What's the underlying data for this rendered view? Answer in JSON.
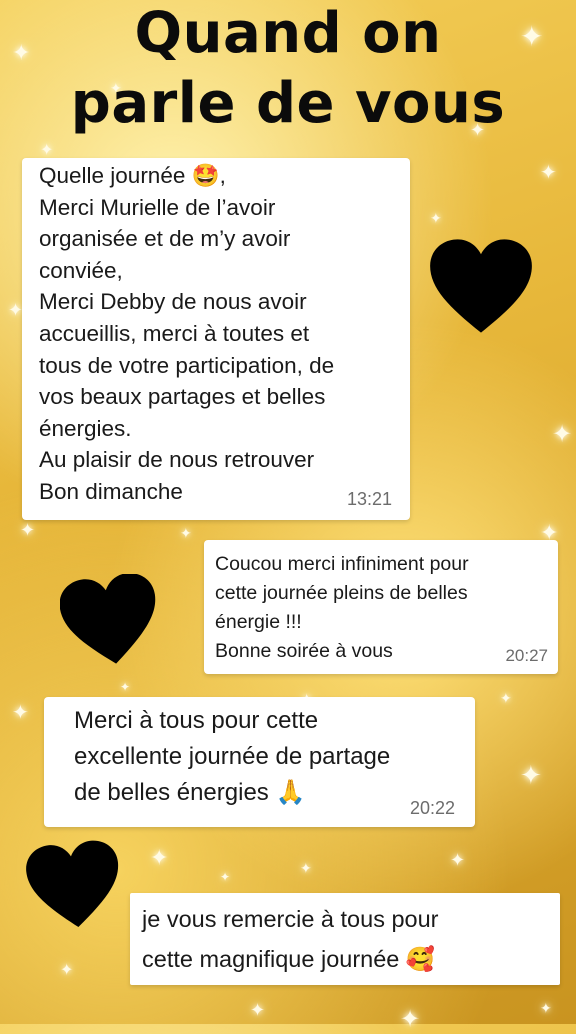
{
  "title": {
    "line1": "Quand on",
    "line2": "parle de vous"
  },
  "messages": [
    {
      "text": "Quelle journée 🤩,\nMerci Murielle de l’avoir\norganisée et de m’y avoir\nconviée,\nMerci Debby de nous avoir\naccueillis, merci à toutes et\ntous de votre participation, de\nvos beaux partages et belles\nénergies.\nAu plaisir de nous retrouver\nBon dimanche",
      "time": "13:21"
    },
    {
      "text": "Coucou merci infiniment pour\ncette journée pleins de belles\nénergie !!!\nBonne soirée à vous",
      "time": "20:27"
    },
    {
      "text": "Merci à tous pour cette\nexcellente journée de partage\nde belles énergies 🙏",
      "time": "20:22"
    },
    {
      "text": "je vous remercie à tous pour\ncette magnifique journée 🥰",
      "time": ""
    }
  ],
  "decorations": {
    "heart_color": "#000000",
    "background_accent": "#e7b73a",
    "heart_icon": "heart-icon",
    "sparkle_icon": "sparkle-icon"
  }
}
